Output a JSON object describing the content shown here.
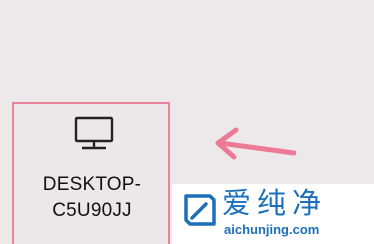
{
  "device": {
    "icon": "monitor-icon",
    "name_line1": "DESKTOP-",
    "name_line2": "C5U90JJ",
    "highlight_color": "#e8849c"
  },
  "annotation": {
    "icon": "pointer-arrow",
    "color": "#ec7a95"
  },
  "watermark": {
    "brand": "爱纯净",
    "url": "aichunjing.com",
    "color": "#1c6fb8"
  }
}
